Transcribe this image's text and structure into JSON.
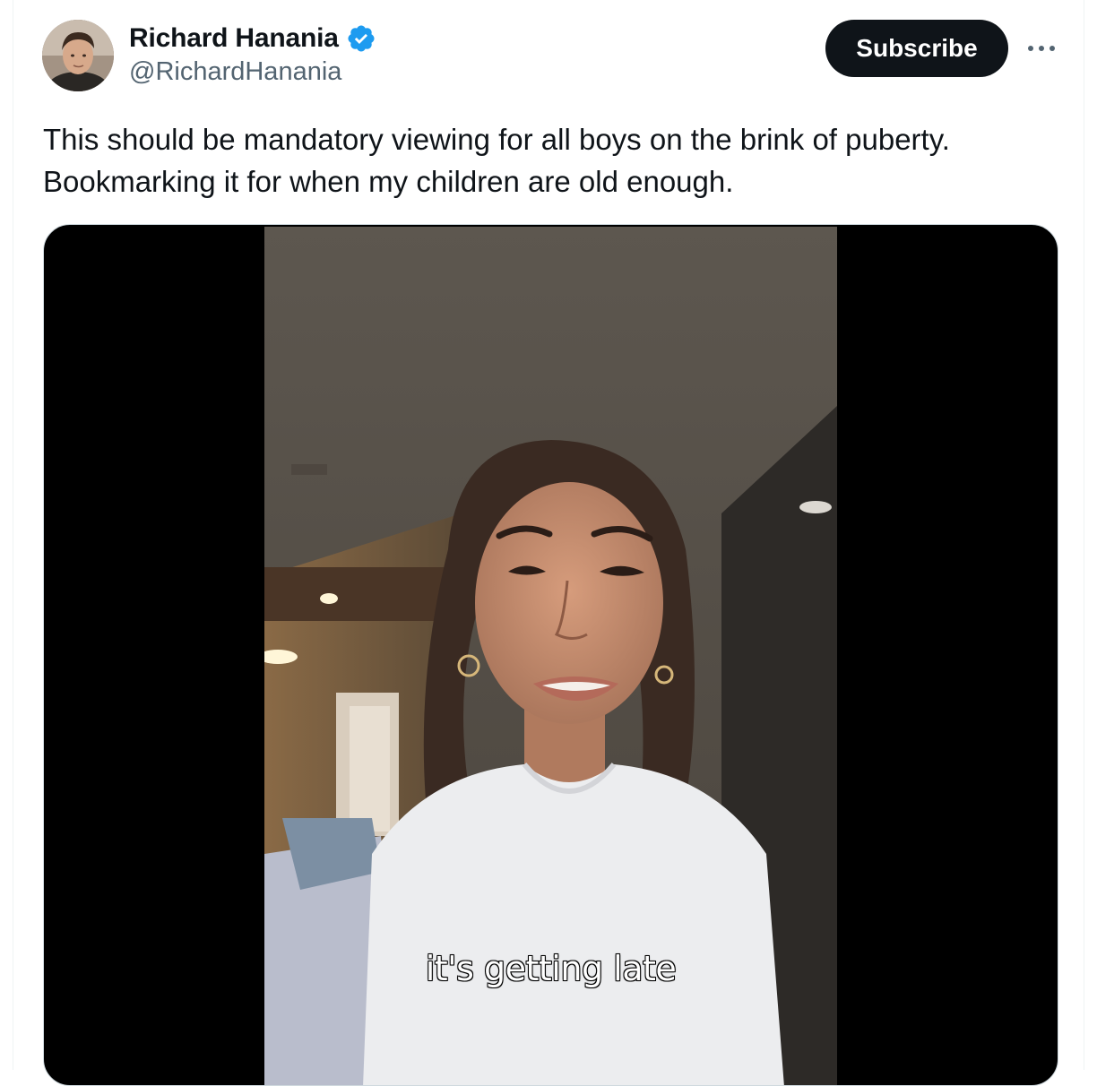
{
  "author": {
    "display_name": "Richard Hanania",
    "handle": "@RichardHanania",
    "verified_icon": "verified-badge-icon",
    "avatar_icon": "avatar"
  },
  "actions": {
    "subscribe_label": "Subscribe",
    "more_icon": "more-options-icon"
  },
  "tweet": {
    "text_line_1": "This should be mandatory viewing for all boys on the brink of puberty.",
    "text_line_2": "Bookmarking it for when my children are old enough."
  },
  "media": {
    "type": "video",
    "caption": "it's getting late"
  },
  "colors": {
    "text_primary": "#0f1419",
    "text_secondary": "#536471",
    "verified_blue": "#1d9bf0",
    "button_bg": "#0f1419",
    "media_border": "#cfd9de"
  }
}
